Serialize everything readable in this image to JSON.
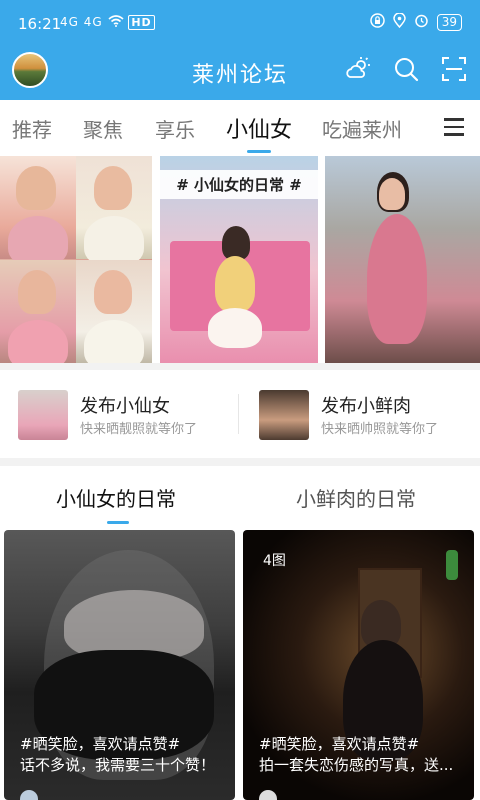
{
  "status": {
    "time": "16:21",
    "signal": "4G 4G",
    "hd": "HD",
    "battery": "39"
  },
  "appbar": {
    "title": "莱州论坛",
    "icons": [
      "weather-icon",
      "search-icon",
      "scan-icon"
    ]
  },
  "tabs": [
    {
      "label": "推荐"
    },
    {
      "label": "聚焦"
    },
    {
      "label": "享乐"
    },
    {
      "label": "小仙女",
      "active": true
    },
    {
      "label": "吃遍莱州"
    }
  ],
  "banner": {
    "tag": "# 小仙女的日常 #"
  },
  "publish": [
    {
      "title": "发布小仙女",
      "sub": "快来晒靓照就等你了"
    },
    {
      "title": "发布小鲜肉",
      "sub": "快来晒帅照就等你了"
    }
  ],
  "subtabs": [
    {
      "label": "小仙女的日常",
      "active": true
    },
    {
      "label": "小鲜肉的日常"
    }
  ],
  "cards": [
    {
      "count": "",
      "line1": "#晒笑脸，喜欢请点赞#",
      "line2": "话不多说，我需要三十个赞！"
    },
    {
      "count": "4图",
      "line1": "#晒笑脸，喜欢请点赞#",
      "line2": "拍一套失恋伤感的写真，送..."
    }
  ],
  "colors": {
    "accent": "#3aa9ea"
  }
}
